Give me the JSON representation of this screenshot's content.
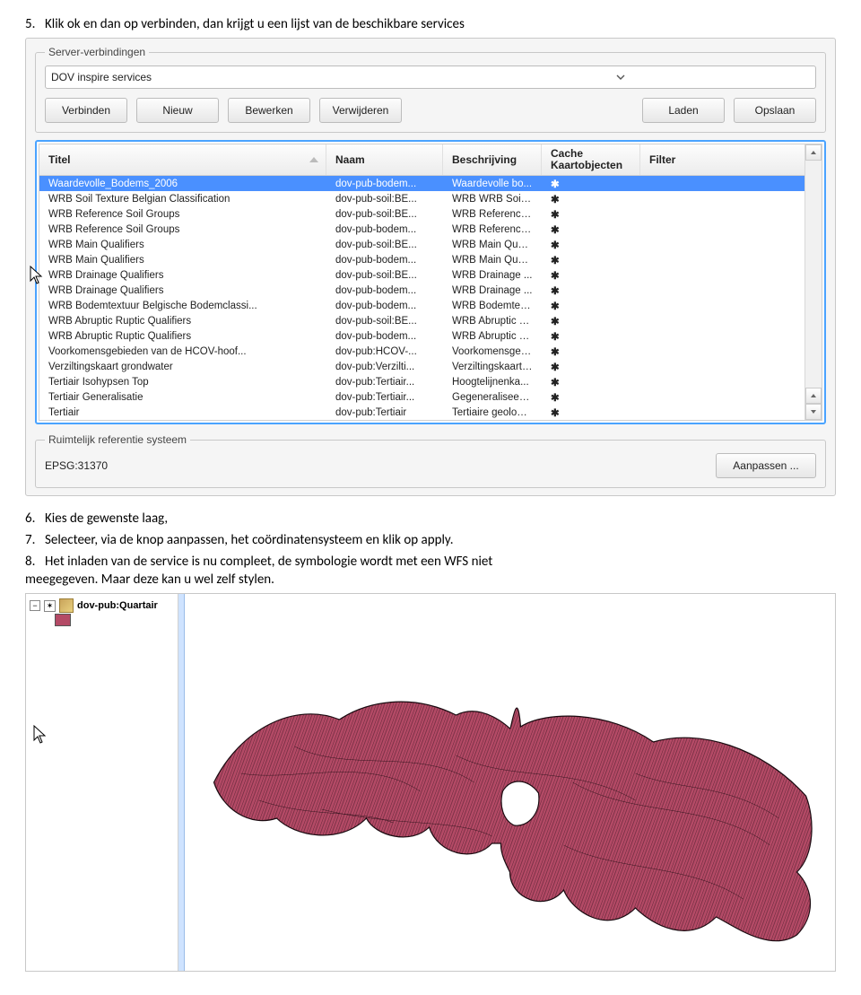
{
  "steps": {
    "s5": "Klik ok en dan op verbinden, dan krijgt u een lijst van de beschikbare services",
    "s6": "Kies de gewenste laag,",
    "s7": "Selecteer, via de knop aanpassen, het coördinatensysteem en klik op apply.",
    "s8a": "Het inladen van de service is nu compleet, de symbologie wordt met een WFS niet",
    "s8b": "meegegeven. Maar deze kan u wel zelf stylen."
  },
  "dialog": {
    "group_server": "Server-verbindingen",
    "combo_value": "DOV inspire services",
    "buttons": {
      "verbinden": "Verbinden",
      "nieuw": "Nieuw",
      "bewerken": "Bewerken",
      "verwijderen": "Verwijderen",
      "laden": "Laden",
      "opslaan": "Opslaan"
    },
    "columns": {
      "titel": "Titel",
      "naam": "Naam",
      "beschrijving": "Beschrijving",
      "cache1": "Cache",
      "cache2": "Kaartobjecten",
      "filter": "Filter"
    },
    "rows": [
      {
        "t": "Waardevolle_Bodems_2006",
        "n": "dov-pub-bodem...",
        "b": "Waardevolle bo...",
        "sel": true
      },
      {
        "t": "WRB Soil Texture Belgian Classification",
        "n": "dov-pub-soil:BE...",
        "b": "WRB WRB Soil T..."
      },
      {
        "t": "WRB Reference Soil Groups",
        "n": "dov-pub-soil:BE...",
        "b": "WRB Reference ..."
      },
      {
        "t": "WRB Reference Soil Groups",
        "n": "dov-pub-bodem...",
        "b": "WRB Reference ..."
      },
      {
        "t": "WRB Main Qualifiers",
        "n": "dov-pub-soil:BE...",
        "b": "WRB Main Qual..."
      },
      {
        "t": "WRB Main Qualifiers",
        "n": "dov-pub-bodem...",
        "b": "WRB Main Qual..."
      },
      {
        "t": "WRB Drainage Qualifiers",
        "n": "dov-pub-soil:BE...",
        "b": "WRB Drainage ..."
      },
      {
        "t": "WRB Drainage Qualifiers",
        "n": "dov-pub-bodem...",
        "b": "WRB Drainage ..."
      },
      {
        "t": "WRB Bodemtextuur Belgische Bodemclassi...",
        "n": "dov-pub-bodem...",
        "b": "WRB Bodemtext..."
      },
      {
        "t": "WRB Abruptic Ruptic Qualifiers",
        "n": "dov-pub-soil:BE...",
        "b": "WRB Abruptic R..."
      },
      {
        "t": "WRB Abruptic Ruptic Qualifiers",
        "n": "dov-pub-bodem...",
        "b": "WRB Abruptic R..."
      },
      {
        "t": "Voorkomensgebieden van de HCOV-hoof...",
        "n": "dov-pub:HCOV-...",
        "b": "Voorkomensgeb..."
      },
      {
        "t": "Verziltingskaart grondwater",
        "n": "dov-pub:Verzilti...",
        "b": "Verziltingskaart ..."
      },
      {
        "t": "Tertiair Isohypsen Top",
        "n": "dov-pub:Tertiair...",
        "b": "Hoogtelijnenka..."
      },
      {
        "t": "Tertiair Generalisatie",
        "n": "dov-pub:Tertiair...",
        "b": "Gegeneraliseerd..."
      },
      {
        "t": "Tertiair",
        "n": "dov-pub:Tertiair",
        "b": "Tertiaire geologi..."
      }
    ],
    "group_crs": "Ruimtelijk referentie systeem",
    "crs_value": "EPSG:31370",
    "btn_aanpassen": "Aanpassen ..."
  },
  "layers": {
    "name": "dov-pub:Quartair"
  }
}
